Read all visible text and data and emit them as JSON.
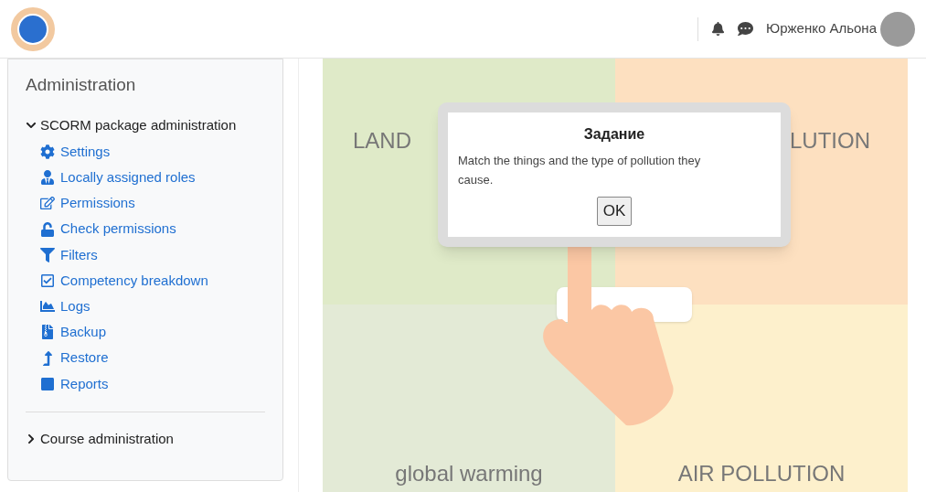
{
  "header": {
    "user_name": "Юрженко Альона"
  },
  "sidebar": {
    "title": "Administration",
    "sections": [
      {
        "label": "SCORM package administration",
        "expanded": true,
        "items": [
          "Settings",
          "Locally assigned roles",
          "Permissions",
          "Check permissions",
          "Filters",
          "Competency breakdown",
          "Logs",
          "Backup",
          "Restore",
          "Reports"
        ]
      },
      {
        "label": "Course administration",
        "expanded": false
      }
    ]
  },
  "activity": {
    "quadrants": [
      {
        "label": "LAND",
        "color": "#dfeac8"
      },
      {
        "label": "LUTION",
        "color": "#fde0c0"
      },
      {
        "label": "global warming",
        "color": "#e3ead6"
      },
      {
        "label": "AIR POLLUTION",
        "color": "#fdf0cc"
      }
    ],
    "dialog": {
      "title": "Задание",
      "message": "Match the things and the type of pollution they cause.",
      "button": "OK"
    }
  }
}
